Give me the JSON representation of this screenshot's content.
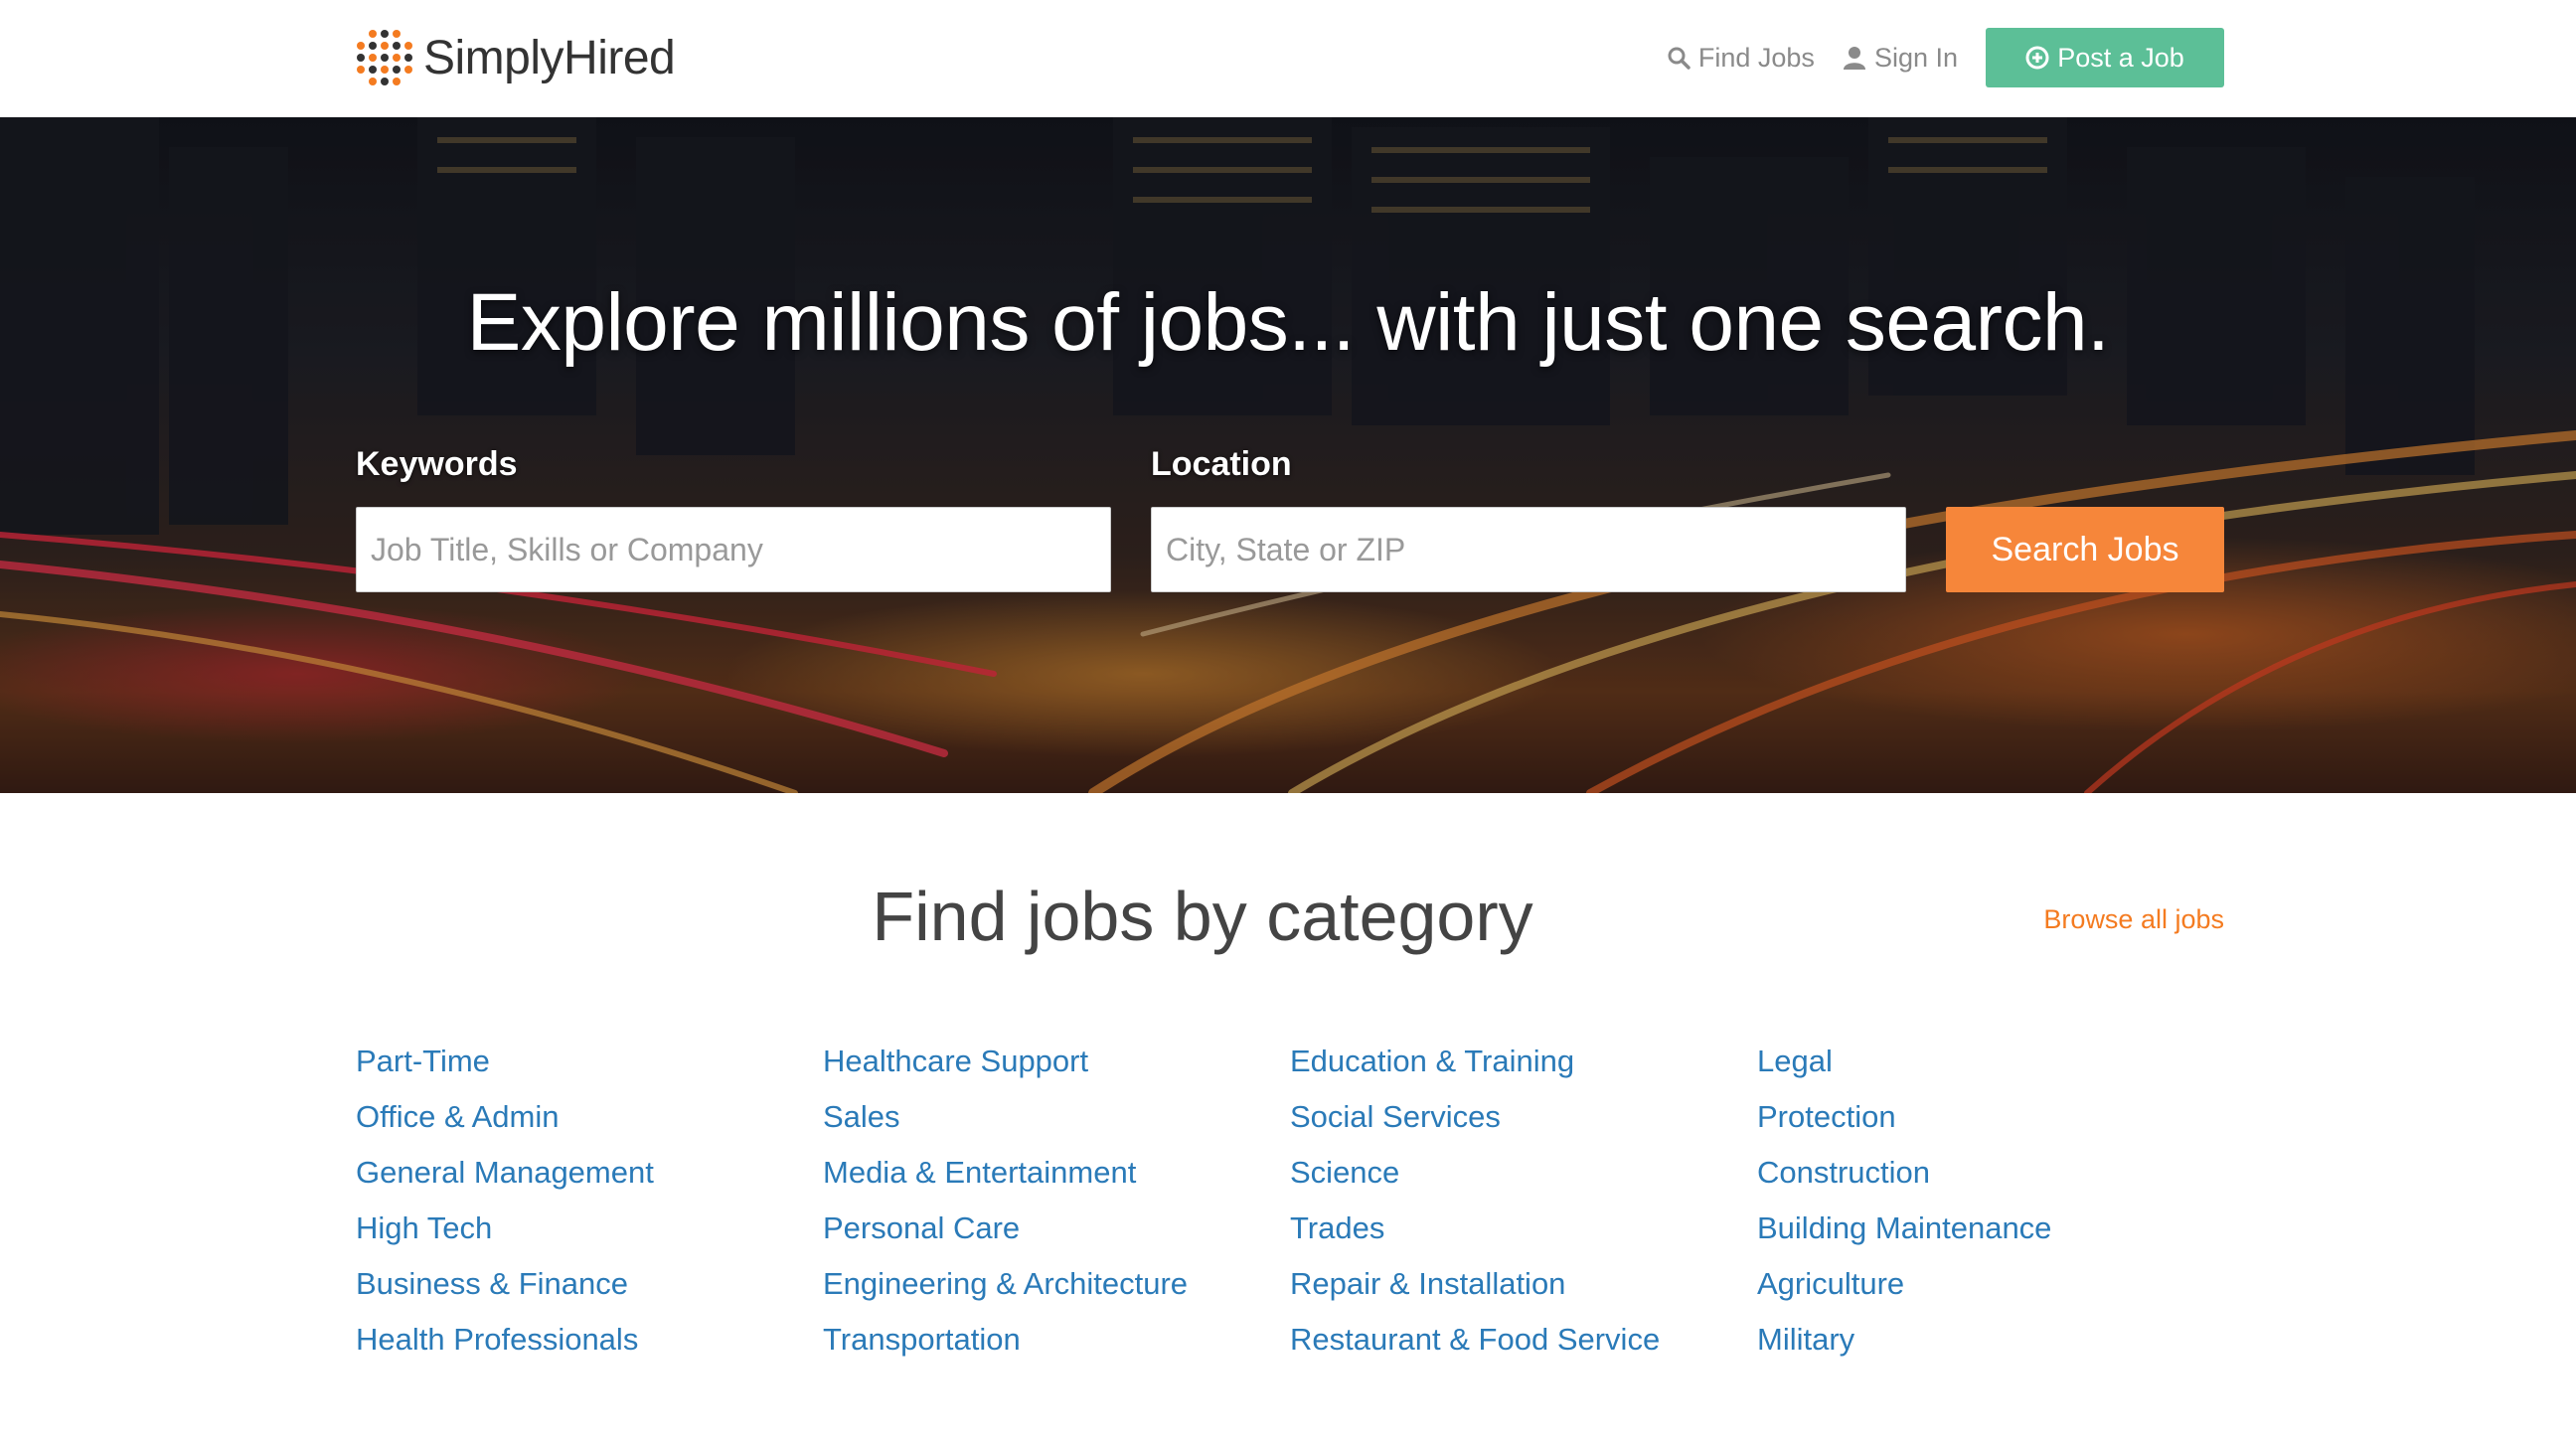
{
  "brand": {
    "name": "SimplyHired"
  },
  "nav": {
    "find_jobs": "Find Jobs",
    "sign_in": "Sign In",
    "post_job": "Post a Job"
  },
  "hero": {
    "headline": "Explore millions of jobs... with just one search.",
    "keywords_label": "Keywords",
    "keywords_placeholder": "Job Title, Skills or Company",
    "location_label": "Location",
    "location_placeholder": "City, State or ZIP",
    "search_button": "Search Jobs"
  },
  "categories": {
    "title": "Find jobs by category",
    "browse_all": "Browse all jobs",
    "columns": [
      [
        "Part-Time",
        "Office & Admin",
        "General Management",
        "High Tech",
        "Business & Finance",
        "Health Professionals"
      ],
      [
        "Healthcare Support",
        "Sales",
        "Media & Entertainment",
        "Personal Care",
        "Engineering & Architecture",
        "Transportation"
      ],
      [
        "Education & Training",
        "Social Services",
        "Science",
        "Trades",
        "Repair & Installation",
        "Restaurant & Food Service"
      ],
      [
        "Legal",
        "Protection",
        "Construction",
        "Building Maintenance",
        "Agriculture",
        "Military"
      ]
    ]
  },
  "colors": {
    "accent_green": "#5cbf97",
    "accent_orange": "#f6863a",
    "link_blue": "#2a7ab8",
    "browse_orange": "#f47b20"
  },
  "icons": [
    "simplyhired-logo-icon",
    "search-icon",
    "user-icon",
    "plus-circle-icon"
  ]
}
